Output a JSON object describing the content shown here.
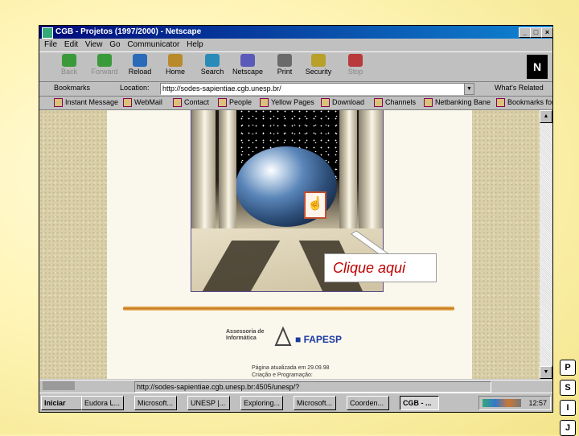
{
  "window": {
    "title": "CGB - Projetos (1997/2000) - Netscape",
    "controls": [
      "_",
      "□",
      "×"
    ]
  },
  "menubar": [
    "File",
    "Edit",
    "View",
    "Go",
    "Communicator",
    "Help"
  ],
  "toolbar": {
    "buttons": [
      {
        "label": "Back",
        "icon": "back-arrow-icon",
        "enabled": false,
        "color": "#3a9a3a"
      },
      {
        "label": "Forward",
        "icon": "forward-arrow-icon",
        "enabled": false,
        "color": "#3a9a3a"
      },
      {
        "label": "Reload",
        "icon": "reload-icon",
        "enabled": true,
        "color": "#2a6ab8"
      },
      {
        "label": "Home",
        "icon": "home-icon",
        "enabled": true,
        "color": "#b88a2a"
      },
      {
        "label": "Search",
        "icon": "search-icon",
        "enabled": true,
        "color": "#2a8ab8"
      },
      {
        "label": "Netscape",
        "icon": "netscape-icon",
        "enabled": true,
        "color": "#5a5ab8"
      },
      {
        "label": "Print",
        "icon": "print-icon",
        "enabled": true,
        "color": "#6a6a6a"
      },
      {
        "label": "Security",
        "icon": "lock-icon",
        "enabled": true,
        "color": "#b8a02a"
      },
      {
        "label": "Stop",
        "icon": "stop-icon",
        "enabled": false,
        "color": "#b83a3a"
      }
    ],
    "brand": "N"
  },
  "location_bar": {
    "bookmarks_label": "Bookmarks",
    "location_label": "Location:",
    "url": "http://sodes-sapientiae.cgb.unesp.br/",
    "whats_related": "What's Related"
  },
  "personal_toolbar": [
    "Instant Message",
    "WebMail",
    "Contact",
    "People",
    "Yellow Pages",
    "Download",
    "Channels",
    "Netbanking Bane",
    "Bookmarks for"
  ],
  "page": {
    "callout": "Clique aqui",
    "logo_left": [
      "Assessoria de",
      "Informática"
    ],
    "logo_right": "FAPESP",
    "updated": [
      "Página atualizada em 29.09.98",
      "Criação e Programação:"
    ]
  },
  "status": {
    "url": "http://sodes-sapientiae.cgb.unesp.br:4505/unesp/?"
  },
  "taskbar": {
    "start": "Iniciar",
    "items": [
      "Eudora L...",
      "Microsoft...",
      "UNESP |...",
      "Exploring...",
      "Microsoft...",
      "Coorden...",
      "CGB - ..."
    ],
    "active_index": 6,
    "clock": "12:57"
  },
  "side_icons": [
    "P",
    "S",
    "I",
    "J"
  ]
}
